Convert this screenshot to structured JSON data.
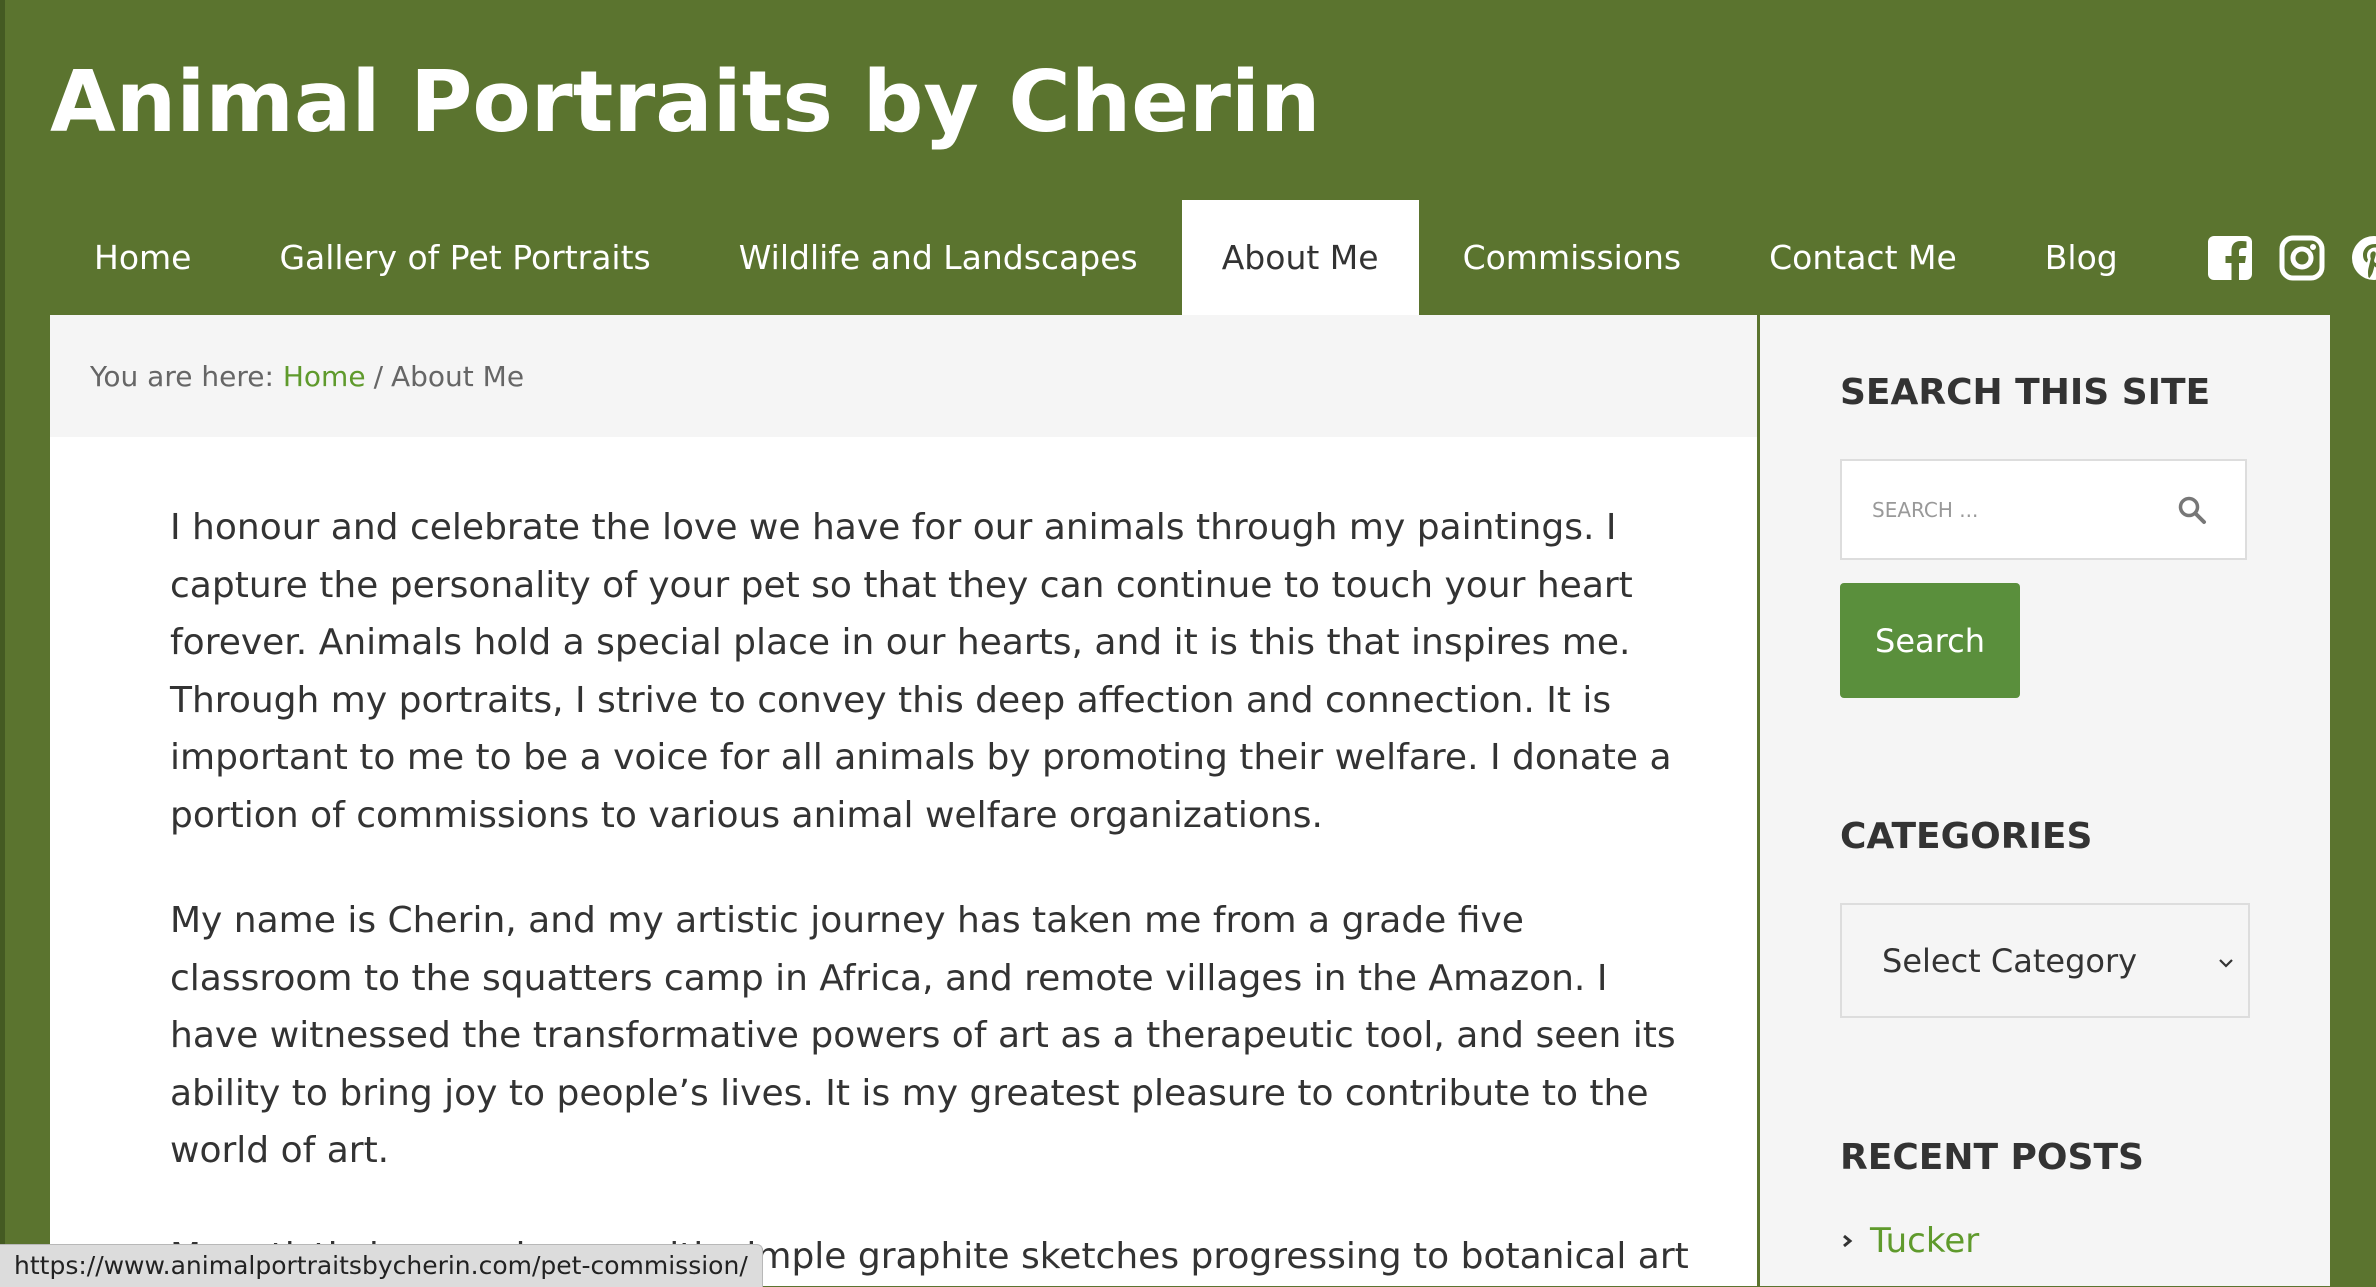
{
  "site": {
    "title": "Animal Portraits by Cherin"
  },
  "nav": {
    "items": [
      {
        "label": "Home"
      },
      {
        "label": "Gallery of Pet Portraits"
      },
      {
        "label": "Wildlife and Landscapes"
      },
      {
        "label": "About Me",
        "active": true
      },
      {
        "label": "Commissions"
      },
      {
        "label": "Contact Me"
      },
      {
        "label": "Blog"
      }
    ],
    "social": [
      "facebook-icon",
      "instagram-icon",
      "pinterest-icon"
    ]
  },
  "breadcrumb": {
    "prefix": "You are here:",
    "home": "Home",
    "separator": "/",
    "current": "About Me"
  },
  "content": {
    "paragraphs": [
      "I honour and celebrate the love we have for our animals through my paintings.  I capture the personality of your pet so that they can continue to touch your heart forever.  Animals hold a special place in our hearts, and it is this that inspires me. Through my portraits, I strive to convey this deep affection and connection. It is important to me to be a voice for all animals by promoting their welfare. I donate a portion of commissions to various animal welfare organizations.",
      "My name is Cherin, and my artistic journey has taken me from a grade five classroom to the squatters camp in Africa, and remote villages in the Amazon. I have witnessed the transformative powers of art as a therapeutic tool, and seen its ability to bring joy to people’s lives. It is my greatest pleasure to contribute to the world of art.",
      "My artistic journey began with simple graphite sketches progressing to botanical art and landscapes of many places. I have explored watercolour and acrylic, but soon"
    ]
  },
  "sidebar": {
    "search": {
      "title": "Search this site",
      "placeholder": "SEARCH ...",
      "button_label": "Search"
    },
    "categories": {
      "title": "Categories",
      "selected": "Select Category"
    },
    "recent_posts": {
      "title": "Recent Posts",
      "items": [
        "Tucker"
      ]
    }
  },
  "status_bar": {
    "url": "https://www.animalportraitsbycherin.com/pet-commission/"
  },
  "colors": {
    "header_bg": "#5b742f",
    "link": "#5f9a2c",
    "button": "#5a8f3c"
  }
}
